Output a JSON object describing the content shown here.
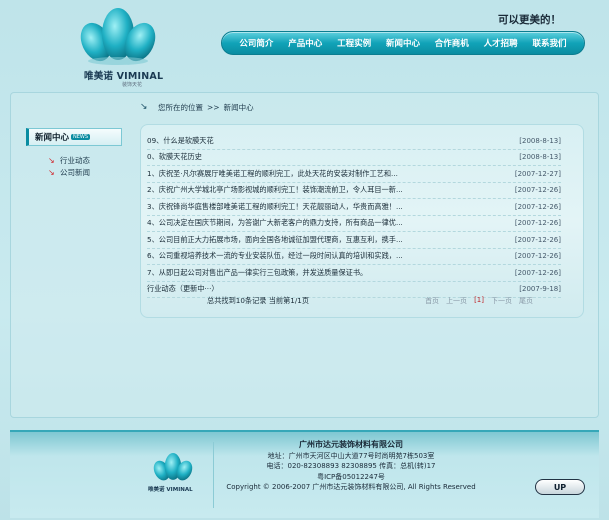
{
  "header": {
    "logo_name": "唯美诺 VIMINAL",
    "logo_sub": "装饰天花",
    "slogan": "可以更美的！",
    "nav": [
      "公司简介",
      "产品中心",
      "工程实例",
      "新闻中心",
      "合作商机",
      "人才招聘",
      "联系我们"
    ]
  },
  "breadcrumb": {
    "label": "您所在的位置",
    "sep": ">>",
    "current": "新闻中心"
  },
  "sidebar": {
    "title": "新闻中心",
    "badge": "NEWS",
    "items": [
      "行业动态",
      "公司新闻"
    ]
  },
  "news": [
    {
      "title": "09、什么是软膜天花",
      "date": "[2008-8-13]"
    },
    {
      "title": "0、软膜天花历史",
      "date": "[2008-8-13]"
    },
    {
      "title": "1、庆祝圣·凡尔赛展厅唯美诺工程的顺利完工，此处天花的安装对制作工艺和...",
      "date": "[2007-12-27]"
    },
    {
      "title": "2、庆祝广州大学城北亭广场影视城的顺利完工！装饰潮流前卫，令人耳目一新...",
      "date": "[2007-12-26]"
    },
    {
      "title": "3、庆祝锋尚华庭售楼部唯美诺工程的顺利完工！天花靓丽动人，华贵而高雅！...",
      "date": "[2007-12-26]"
    },
    {
      "title": "4、公司决定在国庆节期间，为答谢广大新老客户的鼎力支持，所有商品一律优...",
      "date": "[2007-12-26]"
    },
    {
      "title": "5、公司目前正大力拓展市场，面向全国各地诚征加盟代理商，互惠互利，携手...",
      "date": "[2007-12-26]"
    },
    {
      "title": "6、公司重视培养技术一流的专业安装队伍，经过一段时间认真的培训和实践，...",
      "date": "[2007-12-26]"
    },
    {
      "title": "7、从即日起公司对售出产品一律实行三包政策，并发送质量保证书。",
      "date": "[2007-12-26]"
    },
    {
      "title": "行业动态（更新中···）",
      "date": "[2007-9-18]"
    }
  ],
  "pager": {
    "summary": "总共找到10条记录  当前第1/1页",
    "first": "首页",
    "prev": "上一页",
    "current": "[1]",
    "next": "下一页",
    "last": "尾页"
  },
  "footer": {
    "logo_name": "唯美诺 VIMINAL",
    "company": "广州市达元装饰材料有限公司",
    "address": "地址：广州市天河区中山大道77号时尚明苑7栋503室",
    "phone": "电话：020-82308893  82308895  传真：总机(转)17",
    "icp": "粤ICP备05012247号",
    "copyright": "Copyright © 2006-2007 广州市达元装饰材料有限公司, All Rights Reserved",
    "up_label": "UP"
  },
  "colors": {
    "accent": "#0a8ca1",
    "background": "#c9eaef",
    "date_red": "#c0262a"
  }
}
